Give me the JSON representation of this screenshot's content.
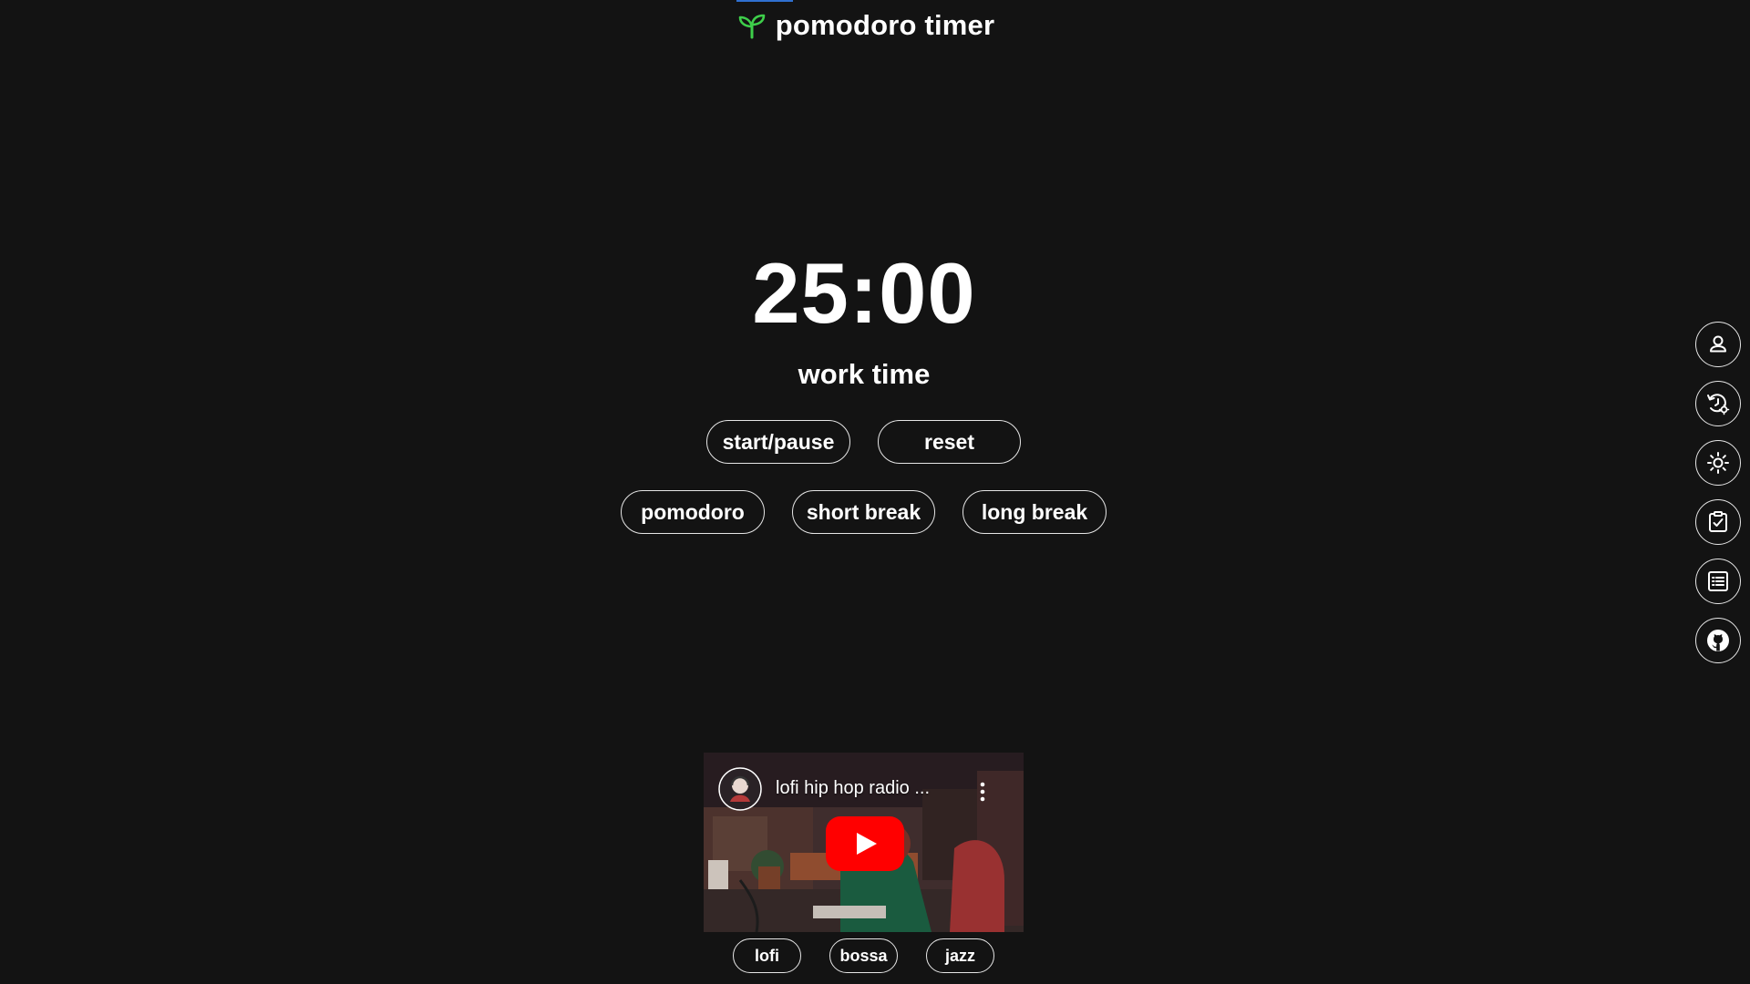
{
  "app": {
    "title": "pomodoro timer",
    "accent_color": "#3ecf4a",
    "logo_icon": "sprout-icon"
  },
  "timer": {
    "display": "25:00",
    "mode_label": "work time"
  },
  "controls": {
    "start_pause_label": "start/pause",
    "reset_label": "reset"
  },
  "modes": [
    {
      "label": "pomodoro"
    },
    {
      "label": "short break"
    },
    {
      "label": "long break"
    }
  ],
  "sidebar": {
    "buttons": [
      {
        "icon": "user-icon"
      },
      {
        "icon": "history-settings-icon"
      },
      {
        "icon": "sun-icon"
      },
      {
        "icon": "clipboard-check-icon"
      },
      {
        "icon": "list-icon"
      },
      {
        "icon": "github-icon"
      }
    ]
  },
  "video": {
    "title": "lofi hip hop radio ...",
    "play_color": "#ff0000"
  },
  "music": {
    "genres": [
      {
        "label": "lofi"
      },
      {
        "label": "bossa"
      },
      {
        "label": "jazz"
      }
    ]
  }
}
